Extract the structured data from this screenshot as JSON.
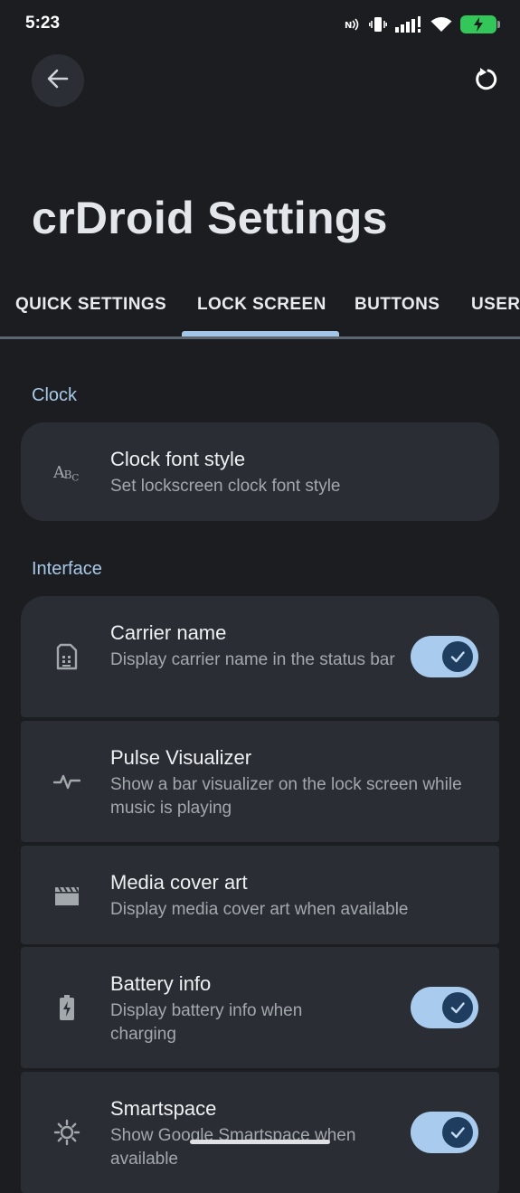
{
  "status_bar": {
    "time": "5:23",
    "battery_color": "#33c759"
  },
  "header": {
    "back_icon": "arrow-left-icon",
    "reset_icon": "reset-icon",
    "title": "crDroid Settings"
  },
  "tabs": [
    {
      "label": "QUICK SETTINGS",
      "selected": false
    },
    {
      "label": "LOCK SCREEN",
      "selected": true
    },
    {
      "label": "BUTTONS",
      "selected": false
    },
    {
      "label": "USER",
      "selected": false
    }
  ],
  "sections": {
    "clock": {
      "header": "Clock",
      "items": [
        {
          "title": "Clock font style",
          "subtitle": "Set lockscreen clock font style",
          "icon": "font-style-icon"
        }
      ]
    },
    "interface": {
      "header": "Interface",
      "items": [
        {
          "title": "Carrier name",
          "subtitle": "Display carrier name in the status bar",
          "icon": "sim-card-icon",
          "toggle": true
        },
        {
          "title": "Pulse Visualizer",
          "subtitle": "Show a bar visualizer on the lock screen while music is playing",
          "icon": "pulse-icon"
        },
        {
          "title": "Media cover art",
          "subtitle": "Display media cover art when available",
          "icon": "movie-icon"
        },
        {
          "title": "Battery info",
          "subtitle": "Display battery info when charging",
          "icon": "battery-charging-icon",
          "toggle": true
        },
        {
          "title": "Smartspace",
          "subtitle": "Show Google Smartspace when available",
          "icon": "smartspace-icon",
          "toggle": true
        }
      ]
    }
  },
  "colors": {
    "background": "#1b1d20",
    "card": "#2a2e34",
    "accent": "#a4c6e6",
    "switch_track": "#a9cbee",
    "switch_thumb": "#1f3e5f"
  }
}
